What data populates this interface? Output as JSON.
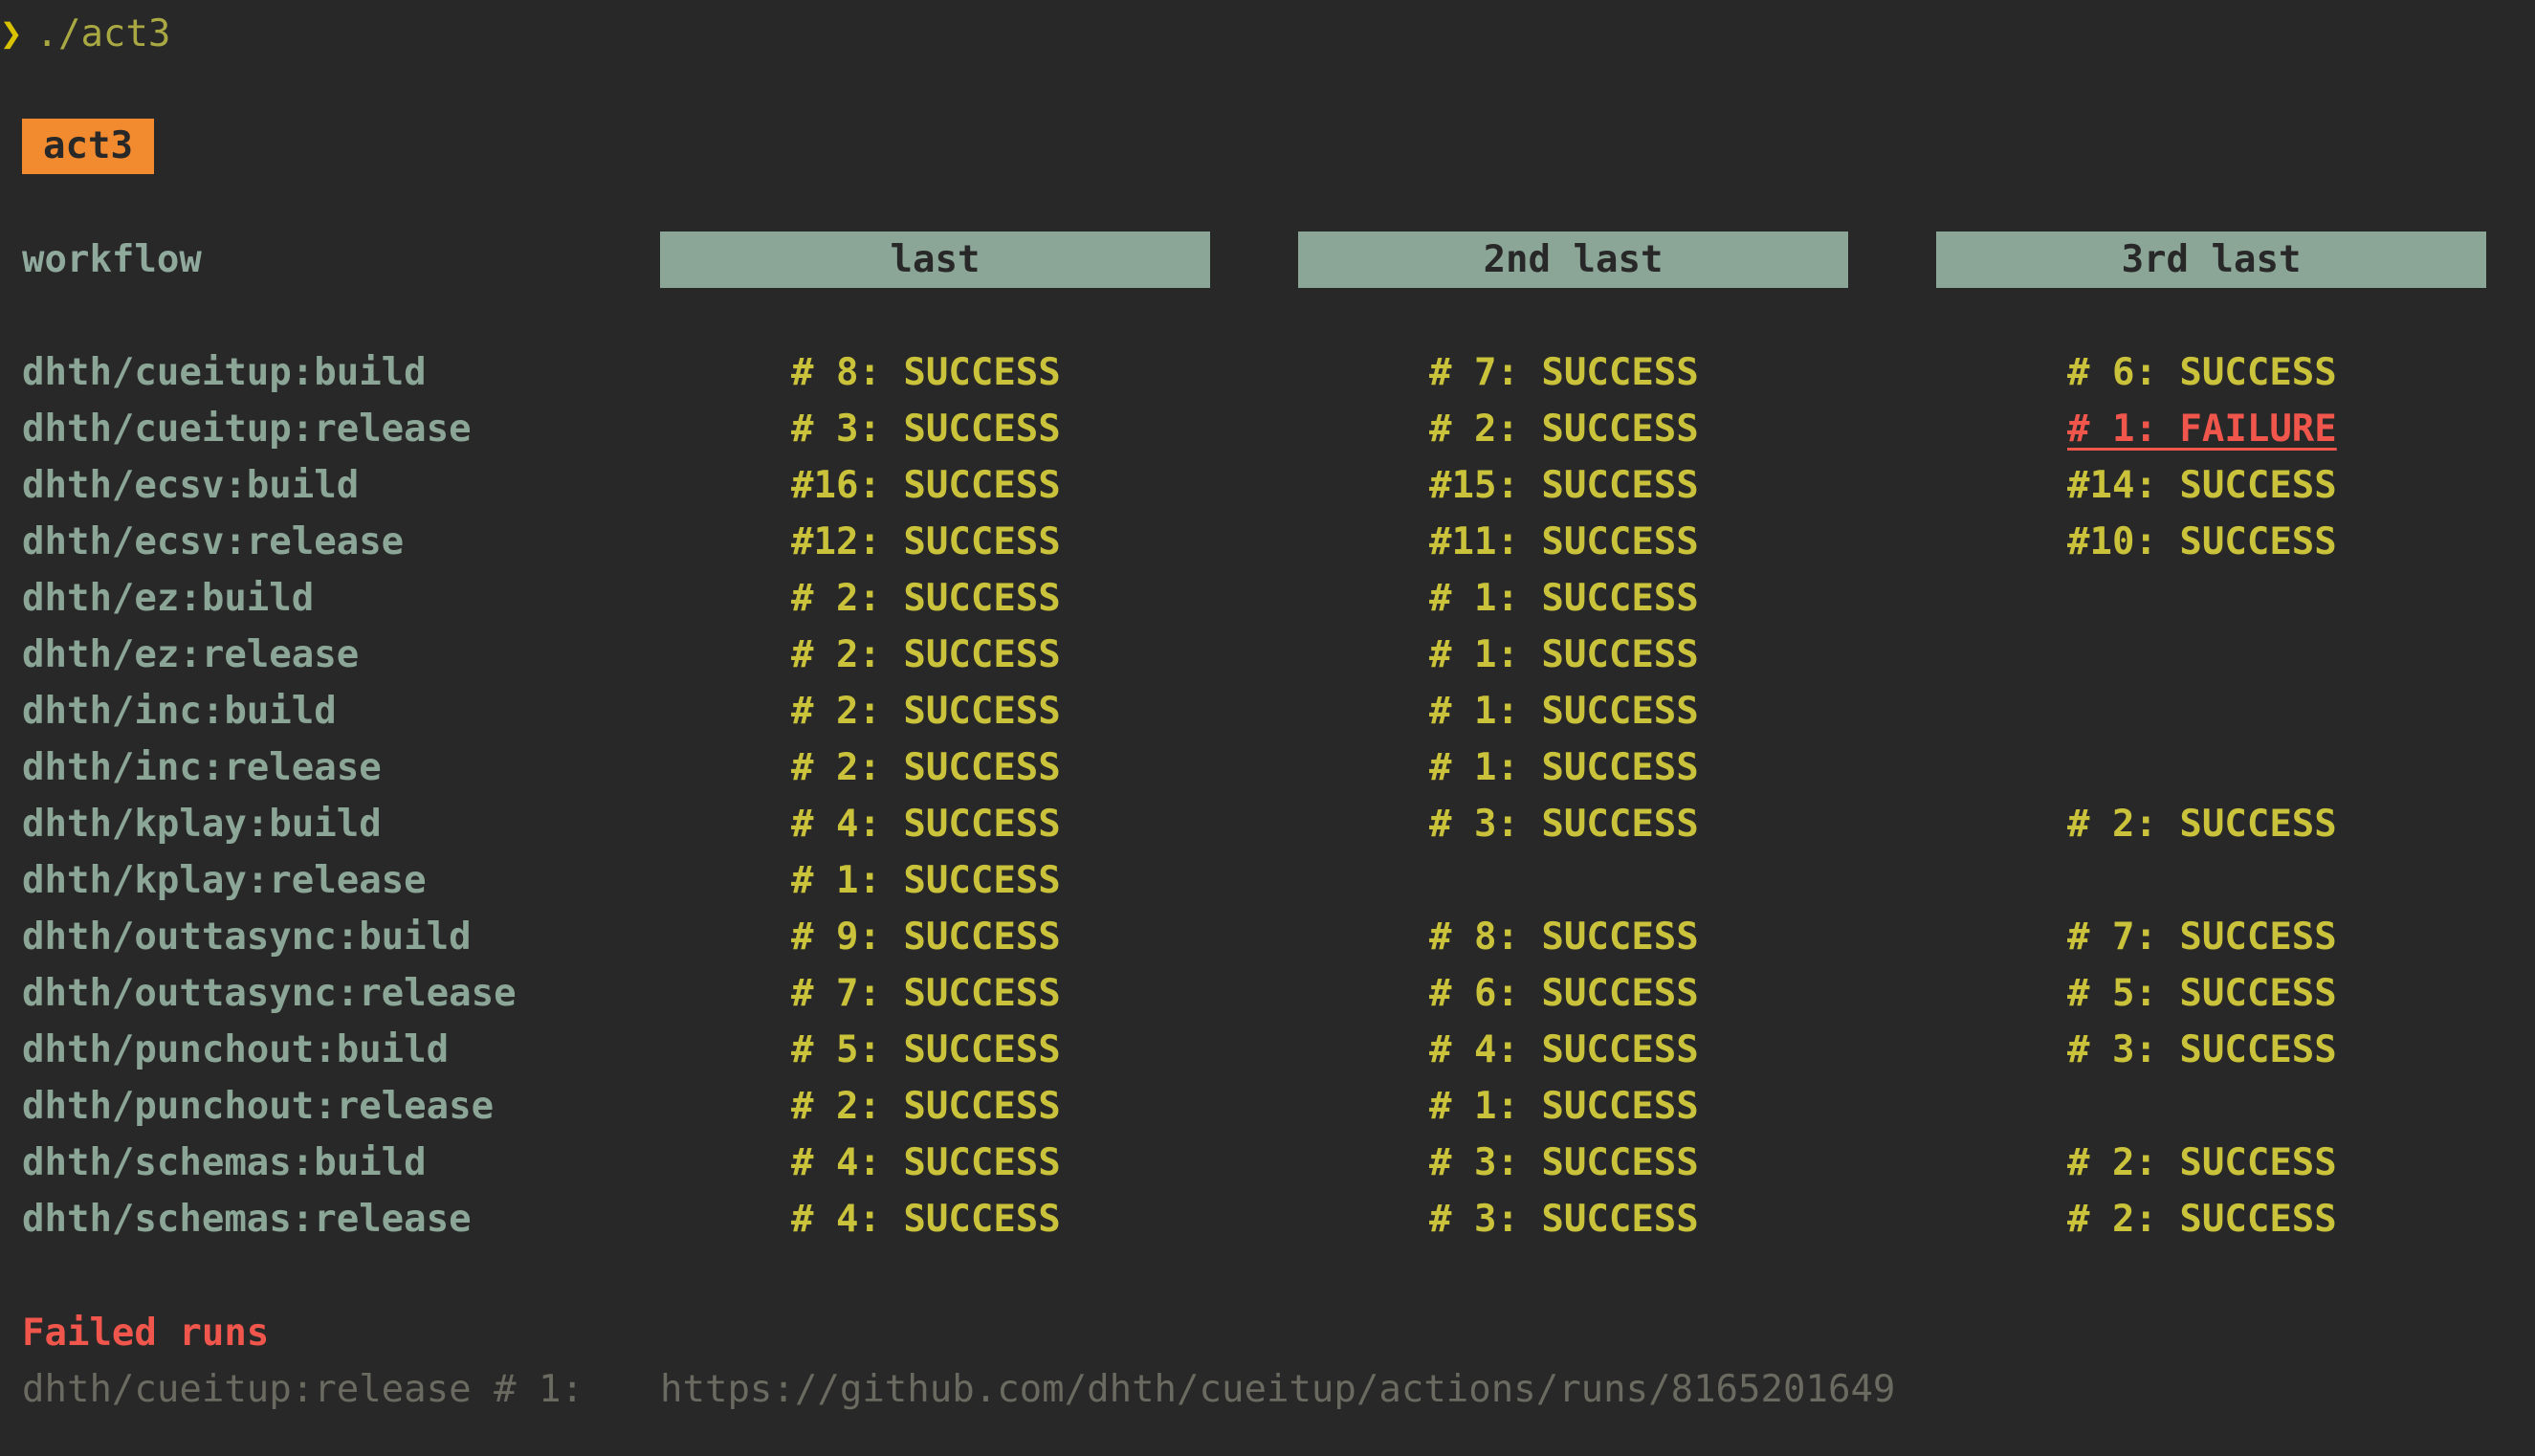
{
  "terminal": {
    "prompt_symbol": "❯",
    "command": "./act3"
  },
  "title": "act3",
  "header": {
    "workflow_label": "workflow",
    "columns": [
      "last",
      "2nd last",
      "3rd last"
    ]
  },
  "rows": [
    {
      "workflow": "dhth/cueitup:build",
      "runs": [
        "# 8: SUCCESS",
        "# 7: SUCCESS",
        "# 6: SUCCESS"
      ]
    },
    {
      "workflow": "dhth/cueitup:release",
      "runs": [
        "# 3: SUCCESS",
        "# 2: SUCCESS",
        "# 1: FAILURE"
      ]
    },
    {
      "workflow": "dhth/ecsv:build",
      "runs": [
        "#16: SUCCESS",
        "#15: SUCCESS",
        "#14: SUCCESS"
      ]
    },
    {
      "workflow": "dhth/ecsv:release",
      "runs": [
        "#12: SUCCESS",
        "#11: SUCCESS",
        "#10: SUCCESS"
      ]
    },
    {
      "workflow": "dhth/ez:build",
      "runs": [
        "# 2: SUCCESS",
        "# 1: SUCCESS",
        ""
      ]
    },
    {
      "workflow": "dhth/ez:release",
      "runs": [
        "# 2: SUCCESS",
        "# 1: SUCCESS",
        ""
      ]
    },
    {
      "workflow": "dhth/inc:build",
      "runs": [
        "# 2: SUCCESS",
        "# 1: SUCCESS",
        ""
      ]
    },
    {
      "workflow": "dhth/inc:release",
      "runs": [
        "# 2: SUCCESS",
        "# 1: SUCCESS",
        ""
      ]
    },
    {
      "workflow": "dhth/kplay:build",
      "runs": [
        "# 4: SUCCESS",
        "# 3: SUCCESS",
        "# 2: SUCCESS"
      ]
    },
    {
      "workflow": "dhth/kplay:release",
      "runs": [
        "# 1: SUCCESS",
        "",
        ""
      ]
    },
    {
      "workflow": "dhth/outtasync:build",
      "runs": [
        "# 9: SUCCESS",
        "# 8: SUCCESS",
        "# 7: SUCCESS"
      ]
    },
    {
      "workflow": "dhth/outtasync:release",
      "runs": [
        "# 7: SUCCESS",
        "# 6: SUCCESS",
        "# 5: SUCCESS"
      ]
    },
    {
      "workflow": "dhth/punchout:build",
      "runs": [
        "# 5: SUCCESS",
        "# 4: SUCCESS",
        "# 3: SUCCESS"
      ]
    },
    {
      "workflow": "dhth/punchout:release",
      "runs": [
        "# 2: SUCCESS",
        "# 1: SUCCESS",
        ""
      ]
    },
    {
      "workflow": "dhth/schemas:build",
      "runs": [
        "# 4: SUCCESS",
        "# 3: SUCCESS",
        "# 2: SUCCESS"
      ]
    },
    {
      "workflow": "dhth/schemas:release",
      "runs": [
        "# 4: SUCCESS",
        "# 3: SUCCESS",
        "# 2: SUCCESS"
      ]
    }
  ],
  "failed_runs": {
    "heading": "Failed runs",
    "items": [
      {
        "label": "dhth/cueitup:release # 1:",
        "url": "https://github.com/dhth/cueitup/actions/runs/8165201649"
      }
    ]
  },
  "colors": {
    "background": "#282828",
    "badge": "#f28b2f",
    "header_box": "#8ba597",
    "success": "#c9c23a",
    "failure": "#f0564b"
  }
}
